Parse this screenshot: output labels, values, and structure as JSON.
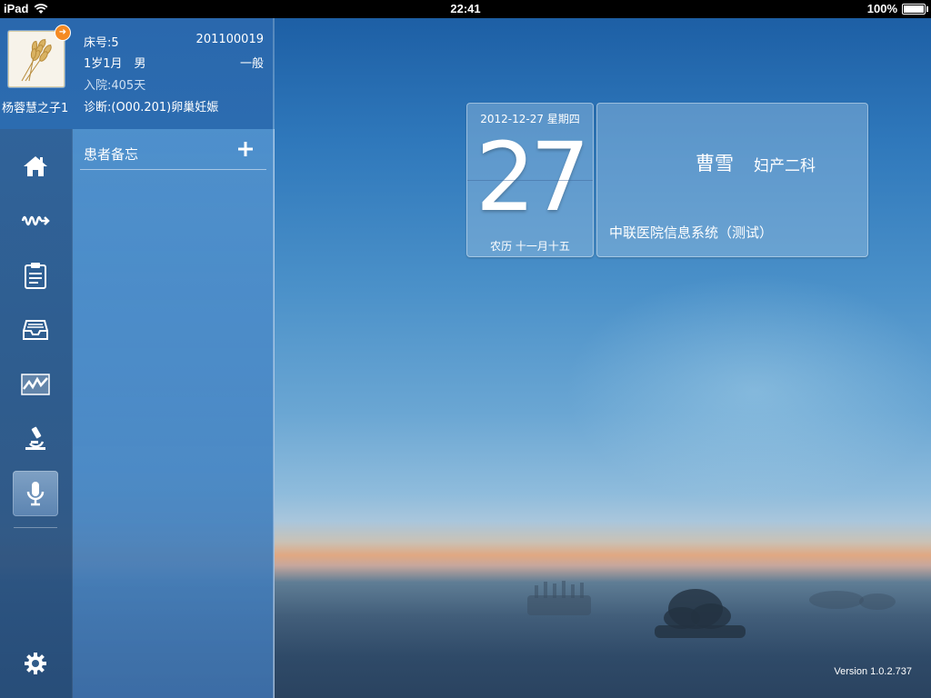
{
  "status_bar": {
    "device": "iPad",
    "time": "22:41",
    "battery": "100%",
    "battery_level": 1.0
  },
  "patient": {
    "name": "杨蓉慧之子1",
    "bed": "床号:5",
    "id": "201100019",
    "age_sex": "1岁1月　男",
    "level": "一般",
    "admission": "入院:405天",
    "diagnosis": "诊断:(O00.201)卵巢妊娠"
  },
  "nav": {
    "items": [
      {
        "name": "home",
        "icon": "home-icon"
      },
      {
        "name": "vitals",
        "icon": "wave-icon"
      },
      {
        "name": "orders",
        "icon": "clipboard-icon"
      },
      {
        "name": "records",
        "icon": "tray-icon"
      },
      {
        "name": "chart",
        "icon": "trend-chart-icon"
      },
      {
        "name": "lab",
        "icon": "microscope-icon"
      },
      {
        "name": "memo",
        "icon": "microphone-icon",
        "active": true
      }
    ],
    "settings_icon": "gear-icon"
  },
  "notes": {
    "title": "患者备忘"
  },
  "date_card": {
    "date": "2012-12-27 星期四",
    "day": "27",
    "lunar": "农历 十一月十五"
  },
  "info_card": {
    "doctor": "曹雪",
    "department": "妇产二科",
    "system": "中联医院信息系统（测试）"
  },
  "version": "Version 1.0.2.737",
  "colors": {
    "accent_badge": "#f58a23",
    "sidebar": "#2c6cb0"
  }
}
